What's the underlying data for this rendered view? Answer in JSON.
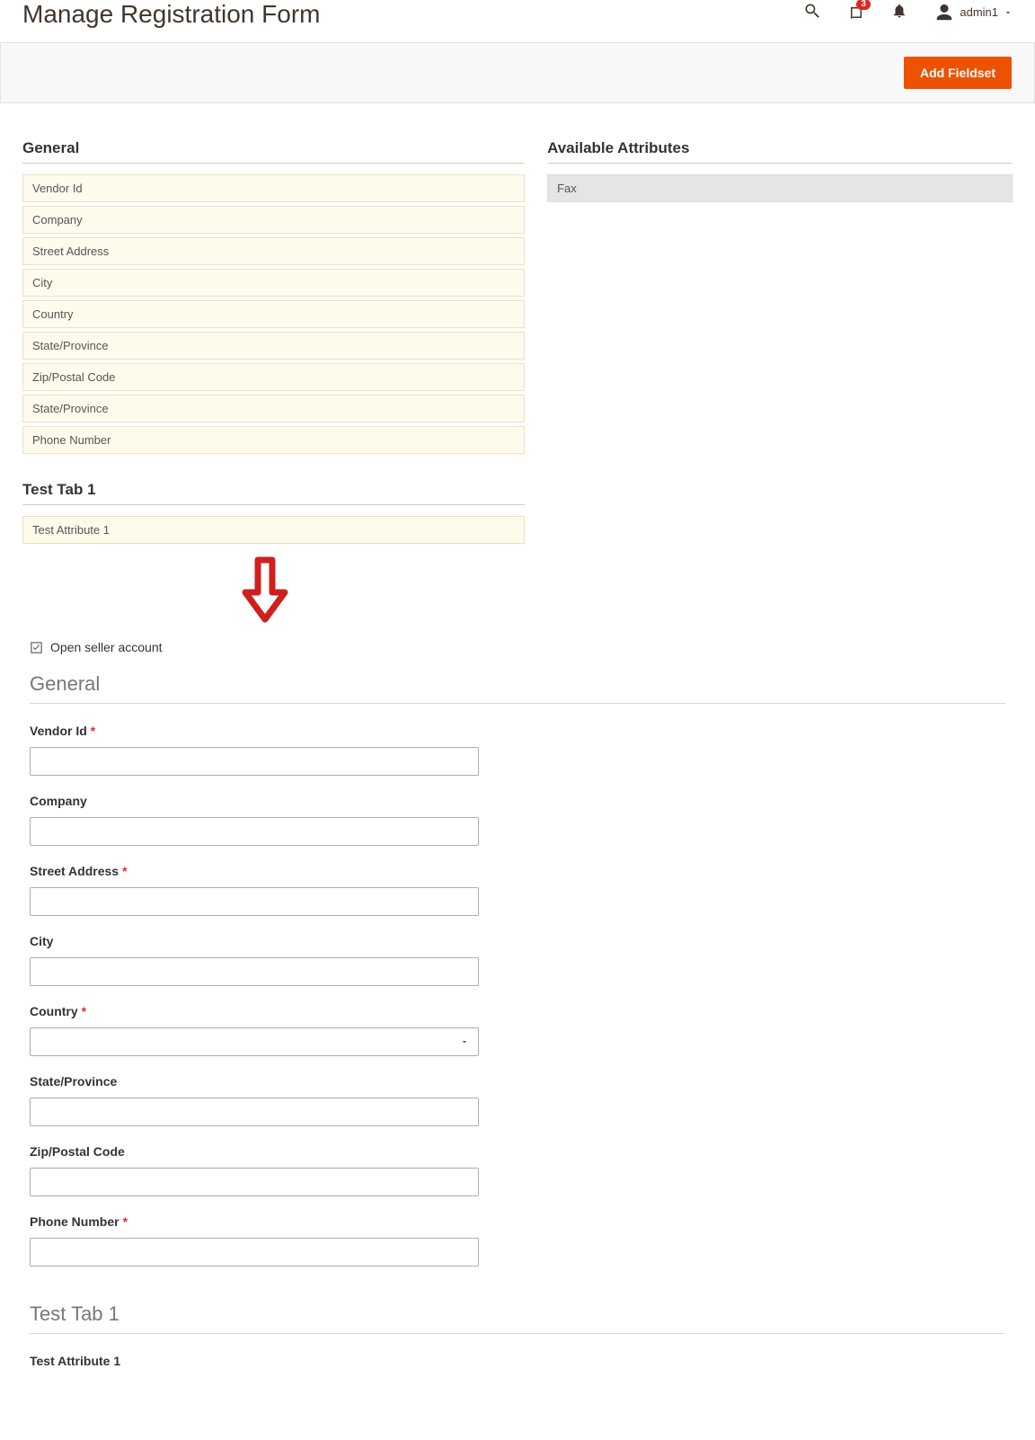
{
  "header": {
    "title": "Manage Registration Form",
    "notification_count": "3",
    "user": "admin1"
  },
  "toolbar": {
    "add_fieldset": "Add Fieldset"
  },
  "admin": {
    "general_title": "General",
    "general_fields": [
      "Vendor Id",
      "Company",
      "Street Address",
      "City",
      "Country",
      "State/Province",
      "Zip/Postal Code",
      "State/Province",
      "Phone Number"
    ],
    "test_tab_title": "Test Tab 1",
    "test_tab_fields": [
      "Test Attribute 1"
    ],
    "available_title": "Available Attributes",
    "available_items": [
      "Fax"
    ]
  },
  "preview": {
    "open_seller": "Open seller account",
    "section_general": "General",
    "section_testtab": "Test Tab 1",
    "fields": {
      "vendor_id": {
        "label": "Vendor Id",
        "required": true
      },
      "company": {
        "label": "Company",
        "required": false
      },
      "street": {
        "label": "Street Address",
        "required": true
      },
      "city": {
        "label": "City",
        "required": false
      },
      "country": {
        "label": "Country",
        "required": true
      },
      "state": {
        "label": "State/Province",
        "required": false
      },
      "zip": {
        "label": "Zip/Postal Code",
        "required": false
      },
      "phone": {
        "label": "Phone Number",
        "required": true
      },
      "test_attr1": {
        "label": "Test Attribute 1",
        "required": false
      }
    }
  }
}
